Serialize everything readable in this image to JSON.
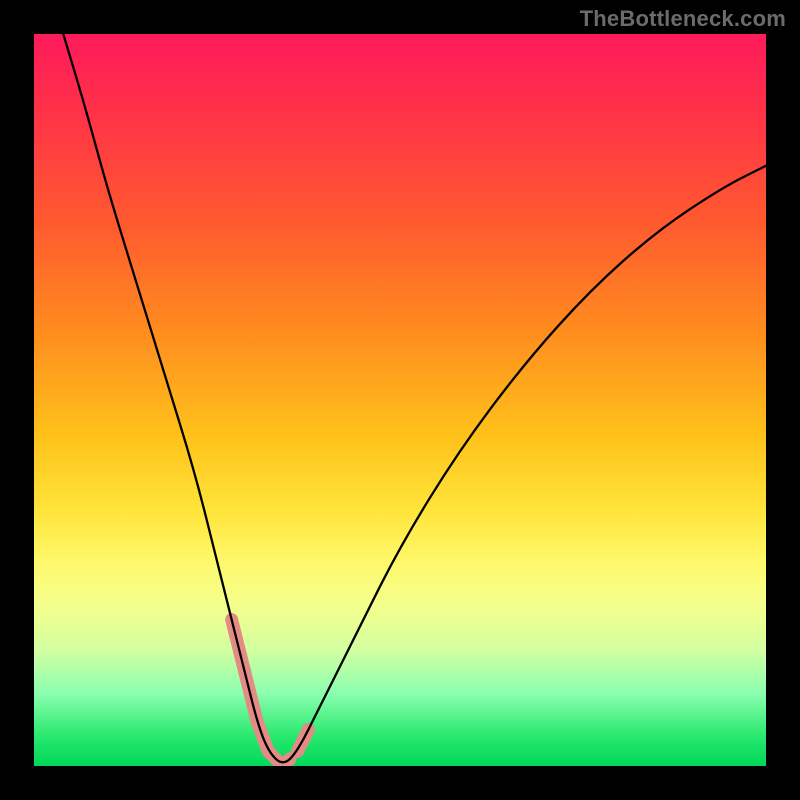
{
  "watermark": "TheBottleneck.com",
  "chart_data": {
    "type": "line",
    "title": "",
    "xlabel": "",
    "ylabel": "",
    "xlim": [
      0,
      100
    ],
    "ylim": [
      0,
      100
    ],
    "grid": false,
    "legend": false,
    "series": [
      {
        "name": "bottleneck-curve",
        "x": [
          4,
          7,
          10,
          14,
          18,
          22,
          25,
          27,
          29,
          30.5,
          32,
          34,
          36,
          39,
          44,
          50,
          58,
          67,
          76,
          85,
          94,
          100
        ],
        "values": [
          100,
          90,
          79,
          66,
          53,
          40,
          28,
          20,
          12,
          6,
          2,
          0,
          2,
          8,
          18,
          30,
          43,
          55,
          65,
          73,
          79,
          82
        ]
      }
    ],
    "highlight_segments": [
      {
        "name": "left-near-min",
        "x_range": [
          27,
          30.5
        ],
        "color": "#e48b86"
      },
      {
        "name": "floor",
        "x_range": [
          30.5,
          35
        ],
        "color": "#e48b86"
      },
      {
        "name": "right-near-min",
        "x_range": [
          36,
          37.5
        ],
        "color": "#e48b86"
      }
    ],
    "background_gradient": {
      "orientation": "vertical",
      "stops": [
        {
          "pos": 0,
          "color": "#ff1a5b"
        },
        {
          "pos": 25,
          "color": "#ff5730"
        },
        {
          "pos": 55,
          "color": "#ffc21a"
        },
        {
          "pos": 78,
          "color": "#f4ff8c"
        },
        {
          "pos": 100,
          "color": "#00d85a"
        }
      ]
    }
  }
}
